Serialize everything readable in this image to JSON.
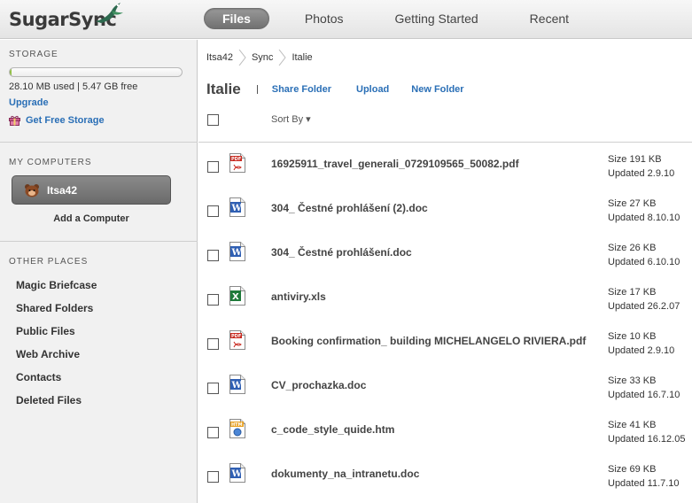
{
  "app": {
    "logo_text": "SugarSync"
  },
  "nav": {
    "items": [
      "Files",
      "Photos",
      "Getting Started",
      "Recent"
    ],
    "active": "Files"
  },
  "sidebar": {
    "storage": {
      "title": "STORAGE",
      "used_text": "28.10 MB used | 5.47 GB free",
      "used_fraction": 0.005,
      "upgrade_label": "Upgrade",
      "free_storage_label": "Get Free Storage"
    },
    "my_computers": {
      "title": "MY COMPUTERS",
      "computer_name": "Itsa42",
      "add_label": "Add a Computer"
    },
    "other_places": {
      "title": "OTHER PLACES",
      "items": [
        "Magic Briefcase",
        "Shared Folders",
        "Public Files",
        "Web Archive",
        "Contacts",
        "Deleted Files"
      ]
    }
  },
  "main": {
    "breadcrumb": [
      "Itsa42",
      "Sync",
      "Italie"
    ],
    "folder_title": "Italie",
    "actions": {
      "share": "Share Folder",
      "upload": "Upload",
      "new_folder": "New Folder"
    },
    "sort_label": "Sort By ▾",
    "files": [
      {
        "name": "16925911_travel_generali_0729109565_50082.pdf",
        "type": "pdf",
        "size": "Size 191 KB",
        "updated": "Updated 2.9.10"
      },
      {
        "name": "304_ Čestné prohlášení (2).doc",
        "type": "doc",
        "size": "Size 27 KB",
        "updated": "Updated 8.10.10"
      },
      {
        "name": "304_ Čestné prohlášení.doc",
        "type": "doc",
        "size": "Size 26 KB",
        "updated": "Updated 6.10.10"
      },
      {
        "name": "antiviry.xls",
        "type": "xls",
        "size": "Size 17 KB",
        "updated": "Updated 26.2.07"
      },
      {
        "name": "Booking confirmation_ building MICHELANGELO RIVIERA.pdf",
        "type": "pdf",
        "size": "Size 10 KB",
        "updated": "Updated 2.9.10"
      },
      {
        "name": "CV_prochazka.doc",
        "type": "doc",
        "size": "Size 33 KB",
        "updated": "Updated 16.7.10"
      },
      {
        "name": "c_code_style_quide.htm",
        "type": "htm",
        "size": "Size 41 KB",
        "updated": "Updated 16.12.05"
      },
      {
        "name": "dokumenty_na_intranetu.doc",
        "type": "doc",
        "size": "Size 69 KB",
        "updated": "Updated 11.7.10"
      }
    ]
  },
  "colors": {
    "link": "#2a6fb6",
    "storage_fill": "#8fbf3f",
    "active_tab": "#7d7d7d"
  }
}
